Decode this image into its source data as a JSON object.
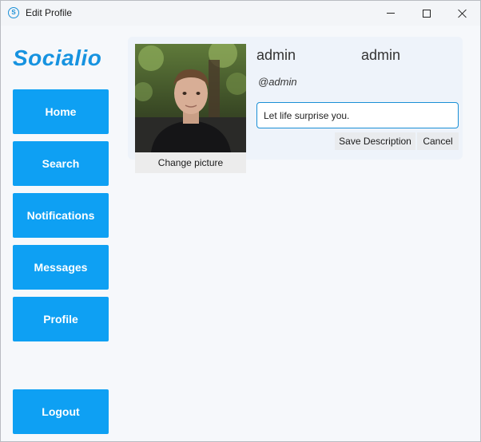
{
  "window": {
    "title": "Edit Profile"
  },
  "sidebar": {
    "logo": "Socialio",
    "items": [
      {
        "label": "Home"
      },
      {
        "label": "Search"
      },
      {
        "label": "Notifications"
      },
      {
        "label": "Messages"
      },
      {
        "label": "Profile"
      }
    ],
    "logout": "Logout"
  },
  "profile": {
    "display_name": "admin",
    "username": "admin",
    "handle": "@admin",
    "change_picture": "Change picture",
    "description": "Let life surprise you.",
    "save_description": "Save Description",
    "cancel": "Cancel"
  },
  "colors": {
    "accent": "#0ea0f3",
    "logo": "#1793e0",
    "card_bg": "#eef3fa",
    "input_border": "#1a8fd6"
  }
}
